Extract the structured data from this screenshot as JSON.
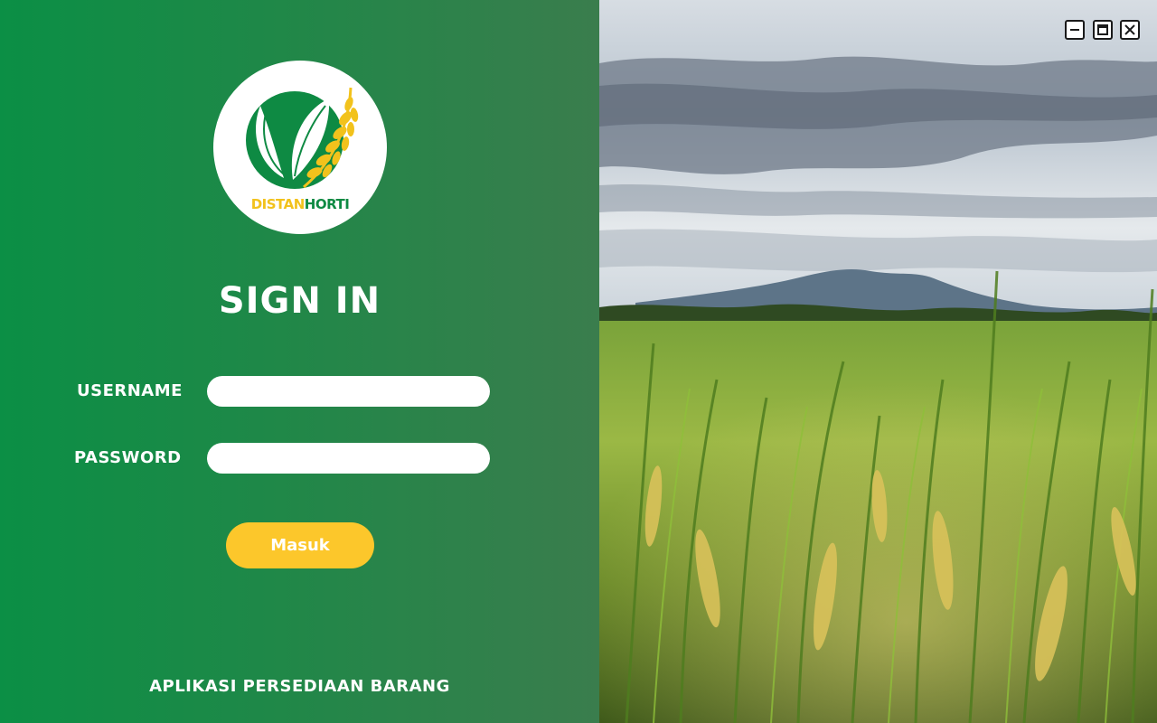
{
  "login": {
    "title": "SIGN IN",
    "username_label": "USERNAME",
    "password_label": "PASSWORD",
    "username_value": "",
    "password_value": "",
    "submit_label": "Masuk",
    "footer": "APLIKASI PERSEDIAAN BARANG"
  },
  "logo": {
    "part1": "DISTAN",
    "part2": "HORTI"
  },
  "window_controls": {
    "minimize_icon": "minimize-icon",
    "maximize_icon": "maximize-icon",
    "close_icon": "close-icon"
  },
  "colors": {
    "panel_green": "#0b8f45",
    "panel_green_dark": "#3a7d4d",
    "button_yellow": "#fcc72b",
    "logo_yellow": "#f2c21c",
    "logo_green": "#0e8a43"
  }
}
